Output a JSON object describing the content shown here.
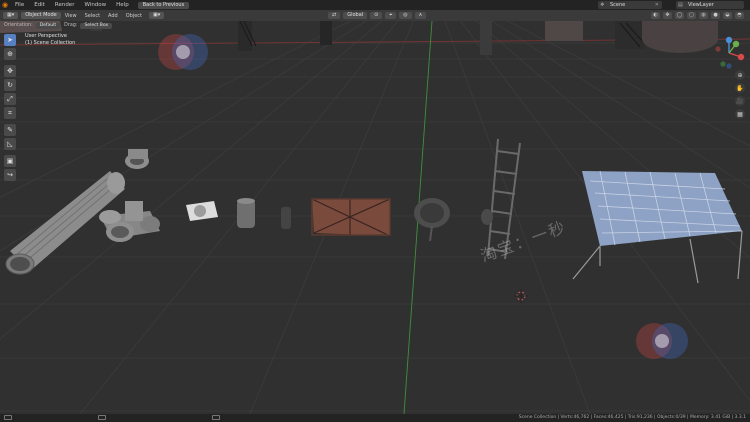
{
  "topbar": {
    "menus": [
      "File",
      "Edit",
      "Render",
      "Window",
      "Help"
    ],
    "back_button": "Back to Previous",
    "scene": "Scene",
    "view_layer": "ViewLayer"
  },
  "header": {
    "mode": "Object Mode",
    "menus": [
      "View",
      "Select",
      "Add",
      "Object"
    ],
    "transform_orientation": "Global"
  },
  "tool_header": {
    "orientation_label": "Orientation:",
    "orientation_value": "Default",
    "drag_label": "Drag:",
    "drag_value": "Select Box"
  },
  "viewport": {
    "perspective": "User Perspective",
    "collection": "(1) Scene Collection"
  },
  "status_bar": {
    "stats": "Scene Collection | Verts:46,762 | Faces:46,425 | Tris:91,236 | Objects:0/39 | Memory: 3.41 GiB | 3.3.1"
  },
  "watermark": {
    "text": "淘宝：一秒"
  },
  "colors": {
    "background": "#303030",
    "grid": "#3a3a3a",
    "y_axis": "#3f8f3f",
    "x_axis": "#8f3f3f",
    "active_tool": "#5680c2",
    "blender_orange": "#e87d0d"
  }
}
